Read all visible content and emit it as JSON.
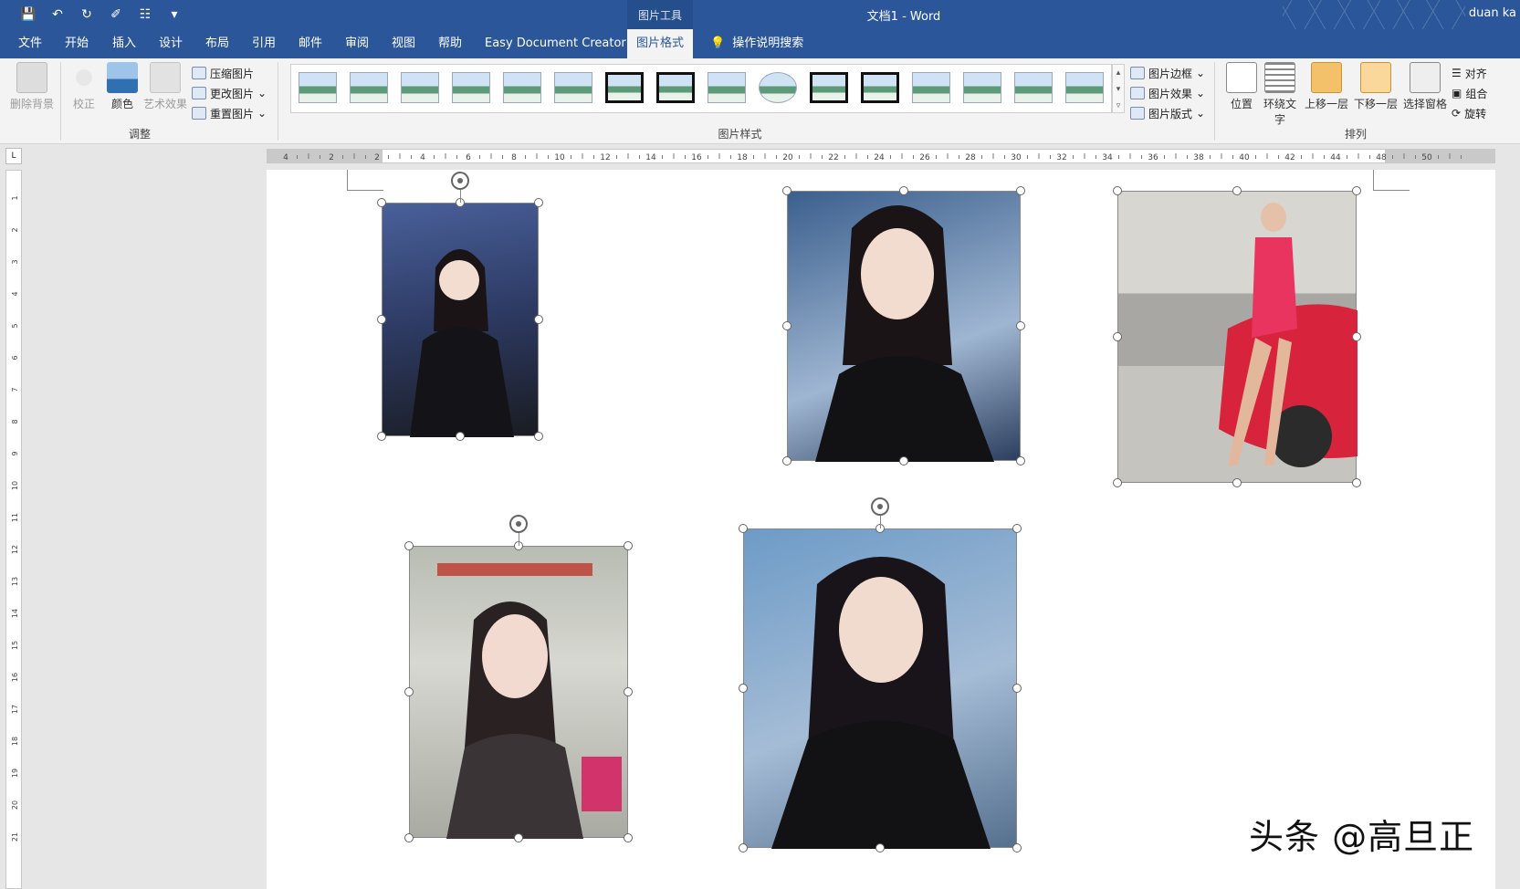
{
  "titlebar": {
    "context_tools": "图片工具",
    "doc_title": "文档1  -  Word",
    "user": "duan ka"
  },
  "tabs": [
    "文件",
    "开始",
    "插入",
    "设计",
    "布局",
    "引用",
    "邮件",
    "审阅",
    "视图",
    "帮助",
    "Easy Document Creator",
    "图片格式"
  ],
  "active_tab": "图片格式",
  "tell_me": "操作说明搜索",
  "ribbon": {
    "adjust": {
      "remove_bg": "删除背景",
      "corrections": "校正",
      "color": "颜色",
      "artistic": "艺术效果",
      "compress": "压缩图片",
      "change": "更改图片",
      "reset": "重置图片",
      "label": "调整"
    },
    "styles": {
      "border": "图片边框",
      "effects": "图片效果",
      "layout": "图片版式",
      "label": "图片样式"
    },
    "arrange": {
      "position": "位置",
      "wrap": "环绕文字",
      "forward": "上移一层",
      "backward": "下移一层",
      "selection": "选择窗格",
      "align": "对齐",
      "group": "组合",
      "rotate": "旋转",
      "label": "排列"
    }
  },
  "ruler": {
    "h_ticks": [
      "4",
      "2",
      "2",
      "4",
      "6",
      "8",
      "10",
      "12",
      "14",
      "16",
      "18",
      "20",
      "22",
      "24",
      "26",
      "28",
      "30",
      "32",
      "34",
      "36",
      "38",
      "40",
      "42",
      "44",
      "48",
      "50"
    ],
    "v_ticks": [
      "1",
      "2",
      "3",
      "4",
      "5",
      "6",
      "7",
      "8",
      "9",
      "10",
      "11",
      "12",
      "13",
      "14",
      "15",
      "16",
      "17",
      "18",
      "19",
      "20",
      "21"
    ]
  },
  "images": [
    {
      "desc": "woman in black blazer, studio background",
      "bg": "#3a4a78",
      "accent": "#1b1b1f"
    },
    {
      "desc": "woman in black blazer, close-up",
      "bg": "#2f4f7a",
      "accent": "#111"
    },
    {
      "desc": "woman in pink dress beside red sports car",
      "bg": "#c9c7c3",
      "accent": "#e4325a"
    },
    {
      "desc": "poster advertisement on wall",
      "bg": "#c7c9c2",
      "accent": "#3d3a38"
    },
    {
      "desc": "woman in black blazer, portrait",
      "bg": "#5e84a8",
      "accent": "#141414"
    }
  ],
  "watermark": "头条 @高旦正"
}
